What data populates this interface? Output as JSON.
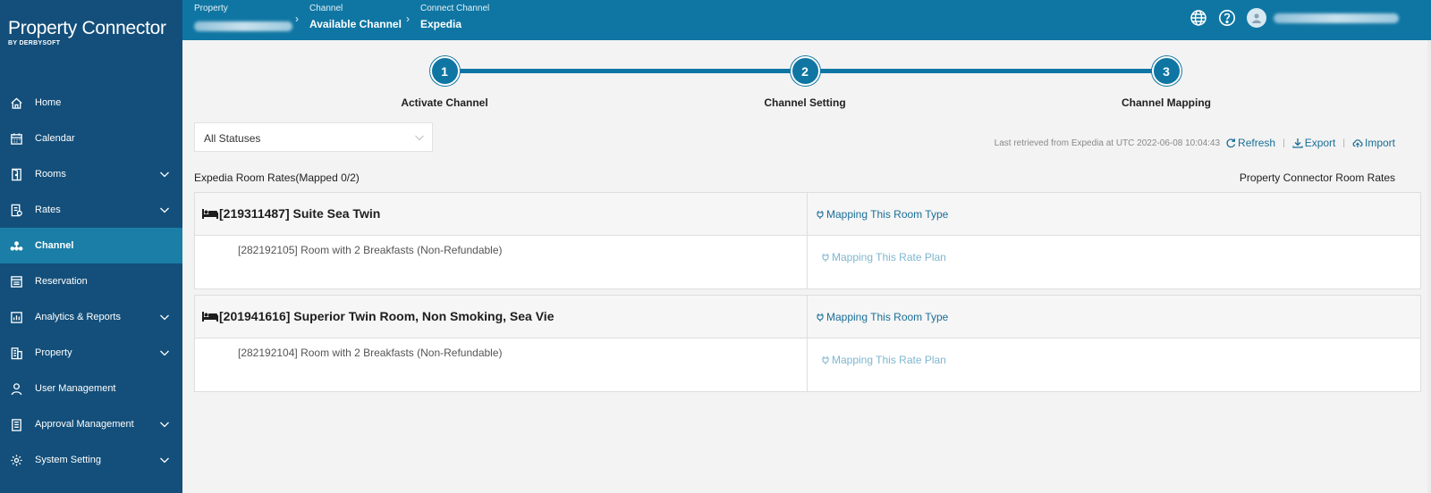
{
  "app": {
    "title": "Property Connector",
    "subtitle": "BY DERBYSOFT"
  },
  "sidebar": {
    "items": [
      {
        "label": "Home",
        "icon": "home-icon",
        "expandable": false,
        "active": false
      },
      {
        "label": "Calendar",
        "icon": "calendar-icon",
        "expandable": false,
        "active": false
      },
      {
        "label": "Rooms",
        "icon": "door-icon",
        "expandable": true,
        "active": false
      },
      {
        "label": "Rates",
        "icon": "rates-icon",
        "expandable": true,
        "active": false
      },
      {
        "label": "Channel",
        "icon": "channel-icon",
        "expandable": false,
        "active": true
      },
      {
        "label": "Reservation",
        "icon": "reservation-icon",
        "expandable": false,
        "active": false
      },
      {
        "label": "Analytics & Reports",
        "icon": "chart-icon",
        "expandable": true,
        "active": false
      },
      {
        "label": "Property",
        "icon": "building-icon",
        "expandable": true,
        "active": false
      },
      {
        "label": "User Management",
        "icon": "user-icon",
        "expandable": false,
        "active": false
      },
      {
        "label": "Approval Management",
        "icon": "clipboard-icon",
        "expandable": true,
        "active": false
      },
      {
        "label": "System Setting",
        "icon": "gear-icon",
        "expandable": true,
        "active": false
      }
    ]
  },
  "breadcrumb": {
    "property_caption": "Property",
    "channel_caption": "Channel",
    "channel_value": "Available Channel",
    "connect_caption": "Connect Channel",
    "connect_value": "Expedia"
  },
  "stepper": {
    "steps": [
      {
        "number": "1",
        "label": "Activate Channel"
      },
      {
        "number": "2",
        "label": "Channel Setting"
      },
      {
        "number": "3",
        "label": "Channel Mapping"
      }
    ]
  },
  "filter": {
    "status_value": "All Statuses"
  },
  "toolbar": {
    "retrieved_text": "Last retrieved from Expedia at UTC 2022-06-08 10:04:43",
    "refresh_label": "Refresh",
    "export_label": "Export",
    "import_label": "Import",
    "separator": "|"
  },
  "section": {
    "left_title": "Expedia Room Rates(Mapped 0/2)",
    "right_title": "Property Connector Room Rates"
  },
  "rooms": [
    {
      "title": "[219311487] Suite Sea Twin",
      "room_link": "Mapping This Room Type",
      "rate": "[282192105] Room with 2 Breakfasts (Non-Refundable)",
      "rate_link": "Mapping This Rate Plan"
    },
    {
      "title": "[201941616] Superior Twin Room, Non Smoking, Sea Vie",
      "room_link": "Mapping This Room Type",
      "rate": "[282192104] Room with 2 Breakfasts (Non-Refundable)",
      "rate_link": "Mapping This Rate Plan"
    }
  ],
  "colors": {
    "sidebar": "#134f7a",
    "sidebar_active": "#1a7ea6",
    "topbar": "#0f76a3",
    "link": "#1a6e96",
    "link_light": "#7fb6cf"
  }
}
